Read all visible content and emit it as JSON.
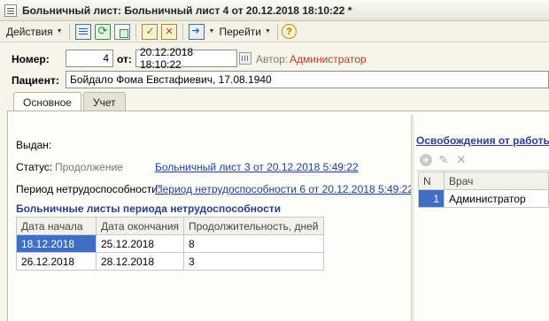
{
  "window": {
    "title": "Больничный лист: Больничный лист 4 от 20.12.2018 18:10:22 *"
  },
  "toolbar": {
    "actions_label": "Действия",
    "goto_label": "Перейти",
    "help_label": "?"
  },
  "header": {
    "number_label": "Номер:",
    "number_value": "4",
    "date_label": "от:",
    "date_value": "20.12.2018 18:10:22",
    "author_label": "Автор:",
    "author_value": "Администратор",
    "patient_label": "Пациент:",
    "patient_value": "Бойдало Фома Евстафиевич, 17.08.1940"
  },
  "tabs": [
    {
      "label": "Основное",
      "active": true
    },
    {
      "label": "Учет",
      "active": false
    }
  ],
  "main": {
    "issued_label": "Выдан:",
    "status_label": "Статус:",
    "status_value": "Продолжение",
    "status_link": "Больничный лист 3 от 20.12.2018 5:49:22",
    "period_label": "Период нетрудоспособности:",
    "period_link": "Период нетрудоспособности 6 от 20.12.2018 5:49:22",
    "sheets_title": "Больничные листы периода нетрудоспособности",
    "sheets_columns": [
      "Дата начала",
      "Дата окончания",
      "Продолжительность, дней"
    ],
    "sheets_rows": [
      [
        "18.12.2018",
        "25.12.2018",
        "8"
      ],
      [
        "26.12.2018",
        "28.12.2018",
        "3"
      ]
    ]
  },
  "release": {
    "title": "Освобождения от работы",
    "columns": [
      "N",
      "Врач"
    ],
    "rows": [
      [
        "1",
        "Администратор"
      ]
    ]
  },
  "colors": {
    "link": "#1f3f9f",
    "section_title": "#2c3f8f",
    "author": "#c0392b",
    "selection": "#3e6fc4"
  }
}
